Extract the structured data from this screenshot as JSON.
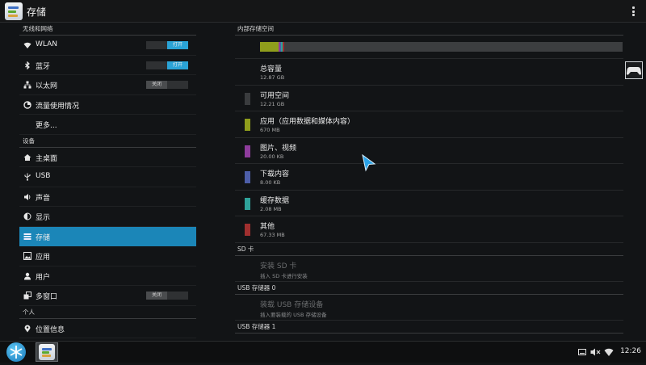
{
  "app": {
    "title": "存储"
  },
  "left_panel": {
    "sections": [
      {
        "header": "无线和网络",
        "items": [
          {
            "label": "WLAN",
            "icon": "wifi-icon",
            "toggle": "打开",
            "toggle_state": "on"
          },
          {
            "label": "蓝牙",
            "icon": "bluetooth-icon",
            "toggle": "打开",
            "toggle_state": "on"
          },
          {
            "label": "以太网",
            "icon": "ethernet-icon",
            "toggle": "关闭",
            "toggle_state": "off"
          },
          {
            "label": "流量使用情况",
            "icon": "data-usage-icon"
          },
          {
            "label": "更多...",
            "icon": ""
          }
        ]
      },
      {
        "header": "设备",
        "items": [
          {
            "label": "主桌面",
            "icon": "home-icon"
          },
          {
            "label": "USB",
            "icon": "usb-icon"
          },
          {
            "label": "声音",
            "icon": "speaker-icon"
          },
          {
            "label": "显示",
            "icon": "display-icon"
          },
          {
            "label": "存储",
            "icon": "storage-icon",
            "selected": true
          },
          {
            "label": "应用",
            "icon": "apps-icon"
          },
          {
            "label": "用户",
            "icon": "user-icon"
          },
          {
            "label": "多窗口",
            "icon": "multiwindow-icon",
            "toggle": "关闭",
            "toggle_state": "off"
          }
        ]
      },
      {
        "header": "个人",
        "items": [
          {
            "label": "位置信息",
            "icon": "location-icon"
          }
        ]
      }
    ]
  },
  "right_panel": {
    "internal_header": "内部存储空间",
    "usage_fraction": {
      "apps": 0.0521,
      "pictures": 0.0016,
      "downloads": 0.0006,
      "cache": 0.0002,
      "other": 0.0052,
      "available": 0.9503
    },
    "stats": [
      {
        "title": "总容量",
        "size": "12.87 GB",
        "color": ""
      },
      {
        "title": "可用空间",
        "size": "12.21 GB",
        "color": "#3a3c3e"
      },
      {
        "title": "应用（应用数据和媒体内容）",
        "size": "670 MB",
        "color": "#8f9d1c"
      },
      {
        "title": "图片、视频",
        "size": "20.00 KB",
        "color": "#8e3c9c"
      },
      {
        "title": "下载内容",
        "size": "8.00 KB",
        "color": "#4d5ea8"
      },
      {
        "title": "缓存数据",
        "size": "2.08 MB",
        "color": "#2fa39a"
      },
      {
        "title": "其他",
        "size": "67.33 MB",
        "color": "#a02f2f"
      }
    ],
    "sd_header": "SD 卡",
    "sd_mount": {
      "title": "安装 SD 卡",
      "subtitle": "插入 SD 卡进行安装"
    },
    "usb0_header": "USB 存储器 0",
    "usb0_mount": {
      "title": "装载 USB 存储设备",
      "subtitle": "插入要装载的 USB 存储设备"
    },
    "usb1_header": "USB 存储器 1"
  },
  "taskbar": {
    "clock": "12:26"
  },
  "colors": {
    "accent": "#1b86b8",
    "toggle_on": "#2aa3d6"
  }
}
